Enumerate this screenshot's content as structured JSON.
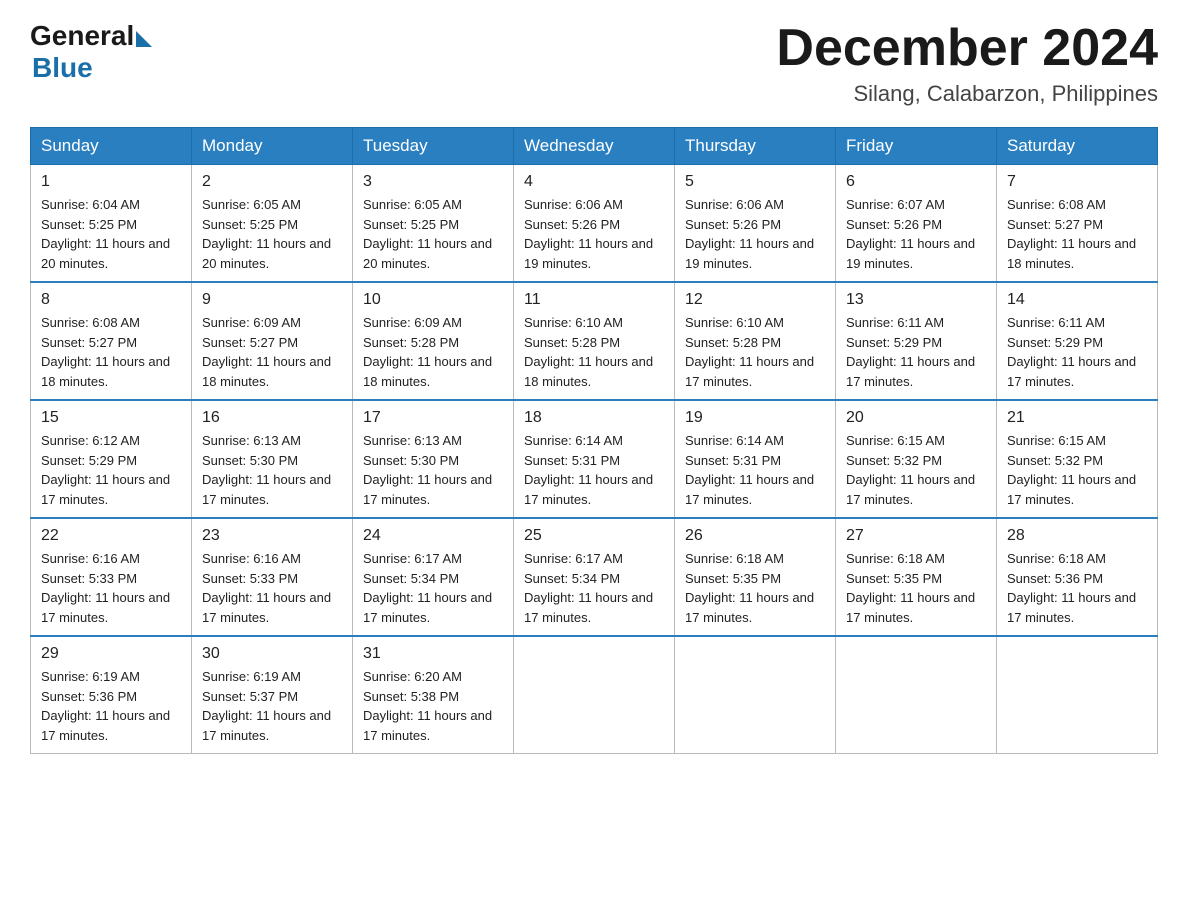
{
  "logo": {
    "general": "General",
    "blue": "Blue"
  },
  "title": "December 2024",
  "location": "Silang, Calabarzon, Philippines",
  "days_of_week": [
    "Sunday",
    "Monday",
    "Tuesday",
    "Wednesday",
    "Thursday",
    "Friday",
    "Saturday"
  ],
  "weeks": [
    [
      {
        "day": "1",
        "sunrise": "6:04 AM",
        "sunset": "5:25 PM",
        "daylight": "11 hours and 20 minutes."
      },
      {
        "day": "2",
        "sunrise": "6:05 AM",
        "sunset": "5:25 PM",
        "daylight": "11 hours and 20 minutes."
      },
      {
        "day": "3",
        "sunrise": "6:05 AM",
        "sunset": "5:25 PM",
        "daylight": "11 hours and 20 minutes."
      },
      {
        "day": "4",
        "sunrise": "6:06 AM",
        "sunset": "5:26 PM",
        "daylight": "11 hours and 19 minutes."
      },
      {
        "day": "5",
        "sunrise": "6:06 AM",
        "sunset": "5:26 PM",
        "daylight": "11 hours and 19 minutes."
      },
      {
        "day": "6",
        "sunrise": "6:07 AM",
        "sunset": "5:26 PM",
        "daylight": "11 hours and 19 minutes."
      },
      {
        "day": "7",
        "sunrise": "6:08 AM",
        "sunset": "5:27 PM",
        "daylight": "11 hours and 18 minutes."
      }
    ],
    [
      {
        "day": "8",
        "sunrise": "6:08 AM",
        "sunset": "5:27 PM",
        "daylight": "11 hours and 18 minutes."
      },
      {
        "day": "9",
        "sunrise": "6:09 AM",
        "sunset": "5:27 PM",
        "daylight": "11 hours and 18 minutes."
      },
      {
        "day": "10",
        "sunrise": "6:09 AM",
        "sunset": "5:28 PM",
        "daylight": "11 hours and 18 minutes."
      },
      {
        "day": "11",
        "sunrise": "6:10 AM",
        "sunset": "5:28 PM",
        "daylight": "11 hours and 18 minutes."
      },
      {
        "day": "12",
        "sunrise": "6:10 AM",
        "sunset": "5:28 PM",
        "daylight": "11 hours and 17 minutes."
      },
      {
        "day": "13",
        "sunrise": "6:11 AM",
        "sunset": "5:29 PM",
        "daylight": "11 hours and 17 minutes."
      },
      {
        "day": "14",
        "sunrise": "6:11 AM",
        "sunset": "5:29 PM",
        "daylight": "11 hours and 17 minutes."
      }
    ],
    [
      {
        "day": "15",
        "sunrise": "6:12 AM",
        "sunset": "5:29 PM",
        "daylight": "11 hours and 17 minutes."
      },
      {
        "day": "16",
        "sunrise": "6:13 AM",
        "sunset": "5:30 PM",
        "daylight": "11 hours and 17 minutes."
      },
      {
        "day": "17",
        "sunrise": "6:13 AM",
        "sunset": "5:30 PM",
        "daylight": "11 hours and 17 minutes."
      },
      {
        "day": "18",
        "sunrise": "6:14 AM",
        "sunset": "5:31 PM",
        "daylight": "11 hours and 17 minutes."
      },
      {
        "day": "19",
        "sunrise": "6:14 AM",
        "sunset": "5:31 PM",
        "daylight": "11 hours and 17 minutes."
      },
      {
        "day": "20",
        "sunrise": "6:15 AM",
        "sunset": "5:32 PM",
        "daylight": "11 hours and 17 minutes."
      },
      {
        "day": "21",
        "sunrise": "6:15 AM",
        "sunset": "5:32 PM",
        "daylight": "11 hours and 17 minutes."
      }
    ],
    [
      {
        "day": "22",
        "sunrise": "6:16 AM",
        "sunset": "5:33 PM",
        "daylight": "11 hours and 17 minutes."
      },
      {
        "day": "23",
        "sunrise": "6:16 AM",
        "sunset": "5:33 PM",
        "daylight": "11 hours and 17 minutes."
      },
      {
        "day": "24",
        "sunrise": "6:17 AM",
        "sunset": "5:34 PM",
        "daylight": "11 hours and 17 minutes."
      },
      {
        "day": "25",
        "sunrise": "6:17 AM",
        "sunset": "5:34 PM",
        "daylight": "11 hours and 17 minutes."
      },
      {
        "day": "26",
        "sunrise": "6:18 AM",
        "sunset": "5:35 PM",
        "daylight": "11 hours and 17 minutes."
      },
      {
        "day": "27",
        "sunrise": "6:18 AM",
        "sunset": "5:35 PM",
        "daylight": "11 hours and 17 minutes."
      },
      {
        "day": "28",
        "sunrise": "6:18 AM",
        "sunset": "5:36 PM",
        "daylight": "11 hours and 17 minutes."
      }
    ],
    [
      {
        "day": "29",
        "sunrise": "6:19 AM",
        "sunset": "5:36 PM",
        "daylight": "11 hours and 17 minutes."
      },
      {
        "day": "30",
        "sunrise": "6:19 AM",
        "sunset": "5:37 PM",
        "daylight": "11 hours and 17 minutes."
      },
      {
        "day": "31",
        "sunrise": "6:20 AM",
        "sunset": "5:38 PM",
        "daylight": "11 hours and 17 minutes."
      },
      null,
      null,
      null,
      null
    ]
  ]
}
